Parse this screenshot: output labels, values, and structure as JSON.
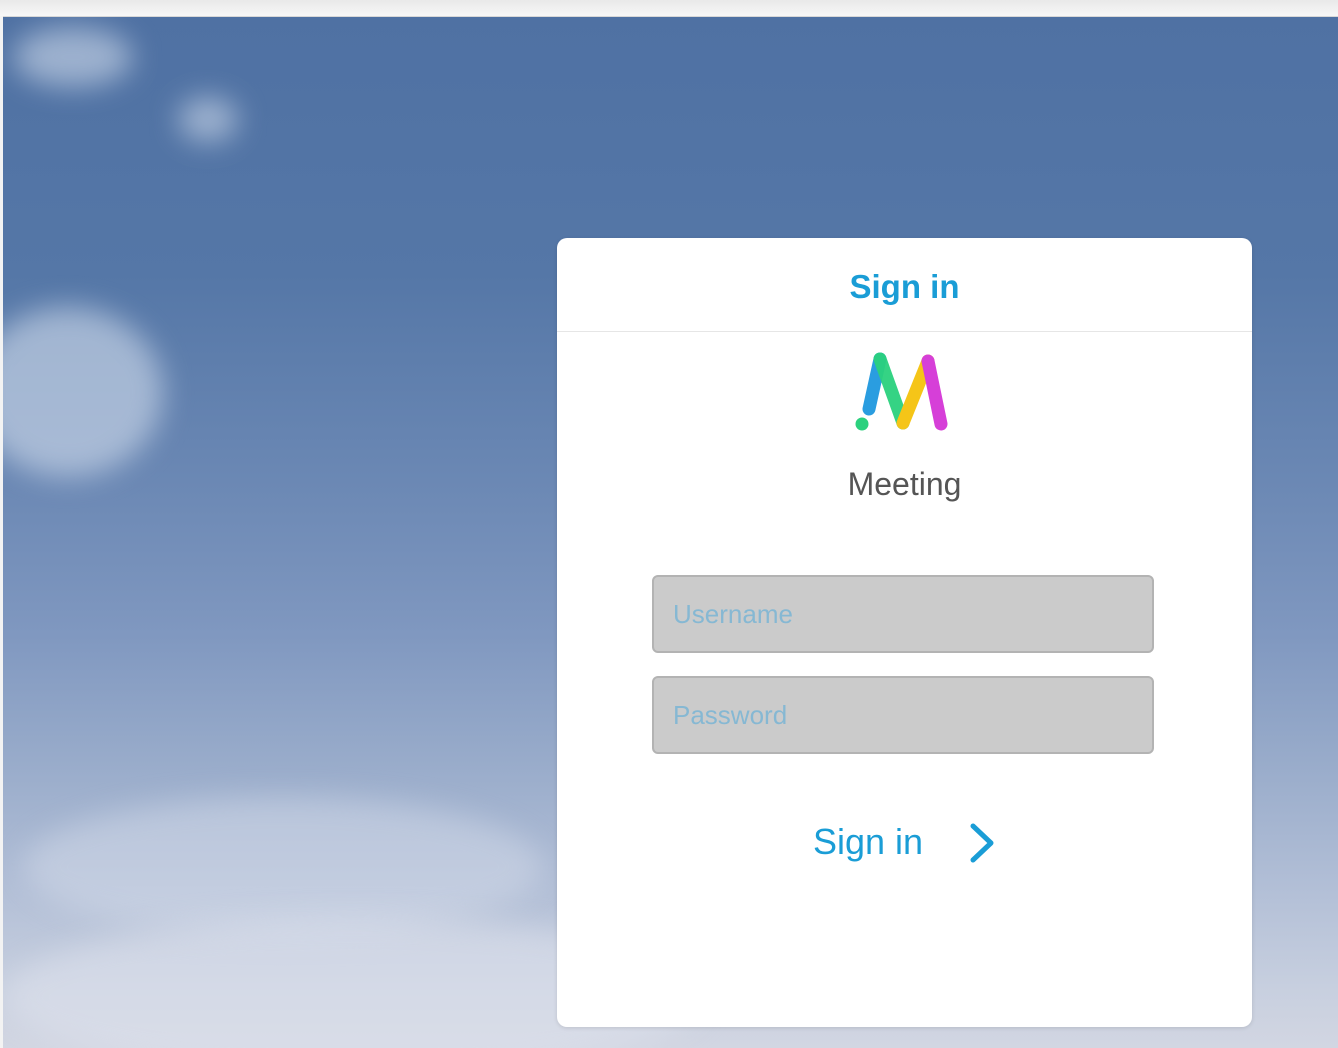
{
  "card": {
    "title": "Sign in",
    "app_name": "Meeting"
  },
  "form": {
    "username_placeholder": "Username",
    "password_placeholder": "Password",
    "submit_label": "Sign in"
  },
  "icons": {
    "logo": "meeting-m-logo",
    "submit": "chevron-right-icon"
  },
  "colors": {
    "accent": "#1a9dd6",
    "field_bg": "#cbcbcb",
    "placeholder": "#86b8d3",
    "logo_blue": "#2a9de0",
    "logo_green": "#2bd17e",
    "logo_yellow": "#f5c518",
    "logo_magenta": "#d63fd8"
  }
}
